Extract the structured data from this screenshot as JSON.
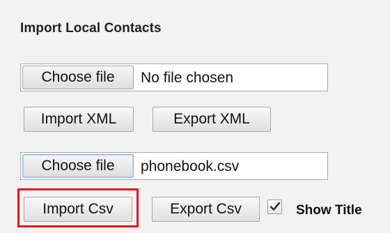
{
  "section": {
    "title": "Import Local Contacts"
  },
  "xml_file": {
    "choose_label": "Choose file",
    "file_name": "No file chosen"
  },
  "xml_buttons": {
    "import_label": "Import XML",
    "export_label": "Export XML"
  },
  "csv_file": {
    "choose_label": "Choose file",
    "file_name": "phonebook.csv"
  },
  "csv_buttons": {
    "import_label": "Import Csv",
    "export_label": "Export Csv"
  },
  "show_title": {
    "label": "Show Title",
    "checked": true
  },
  "colors": {
    "highlight": "#e8101d",
    "background": "#f2f2f2"
  }
}
